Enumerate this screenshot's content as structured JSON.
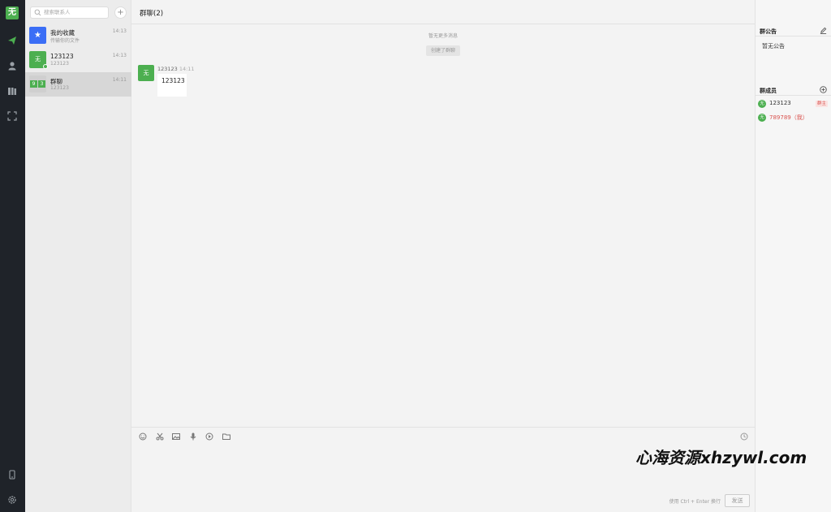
{
  "rail": {
    "logo": "无"
  },
  "list": {
    "search_placeholder": "搜索联系人",
    "add": "+",
    "items": [
      {
        "name": "我的收藏",
        "sub": "传输你的文件",
        "time": "14:13",
        "avatar": "★",
        "color": "#3b6ef6"
      },
      {
        "name": "123123",
        "sub": "123123",
        "time": "14:13",
        "avatar": "无",
        "color": "#4caf50"
      },
      {
        "name": "群聊",
        "sub": "123123",
        "time": "14:11",
        "avatar": "",
        "color": "#cfcfcf"
      }
    ],
    "group_avatar": [
      "9",
      "3"
    ]
  },
  "chat": {
    "title": "群聊(2)",
    "no_more": "暂无更多消息",
    "system": "创建了群聊",
    "message": {
      "avatar": "无",
      "sender": "123123",
      "time": "14:11",
      "text": "123123"
    },
    "hint": "使用 Ctrl + Enter 换行",
    "send": "发送"
  },
  "side": {
    "announcement_title": "群公告",
    "announcement": "暂无公告",
    "members_title": "群成员",
    "members": [
      {
        "avatar": "无",
        "name": "123123",
        "role": "群主",
        "color": "#333333"
      },
      {
        "avatar": "无",
        "name": "789789（我）",
        "role": "",
        "color": "#d9534f"
      }
    ]
  },
  "watermark": "心海资源xhzywl.com"
}
